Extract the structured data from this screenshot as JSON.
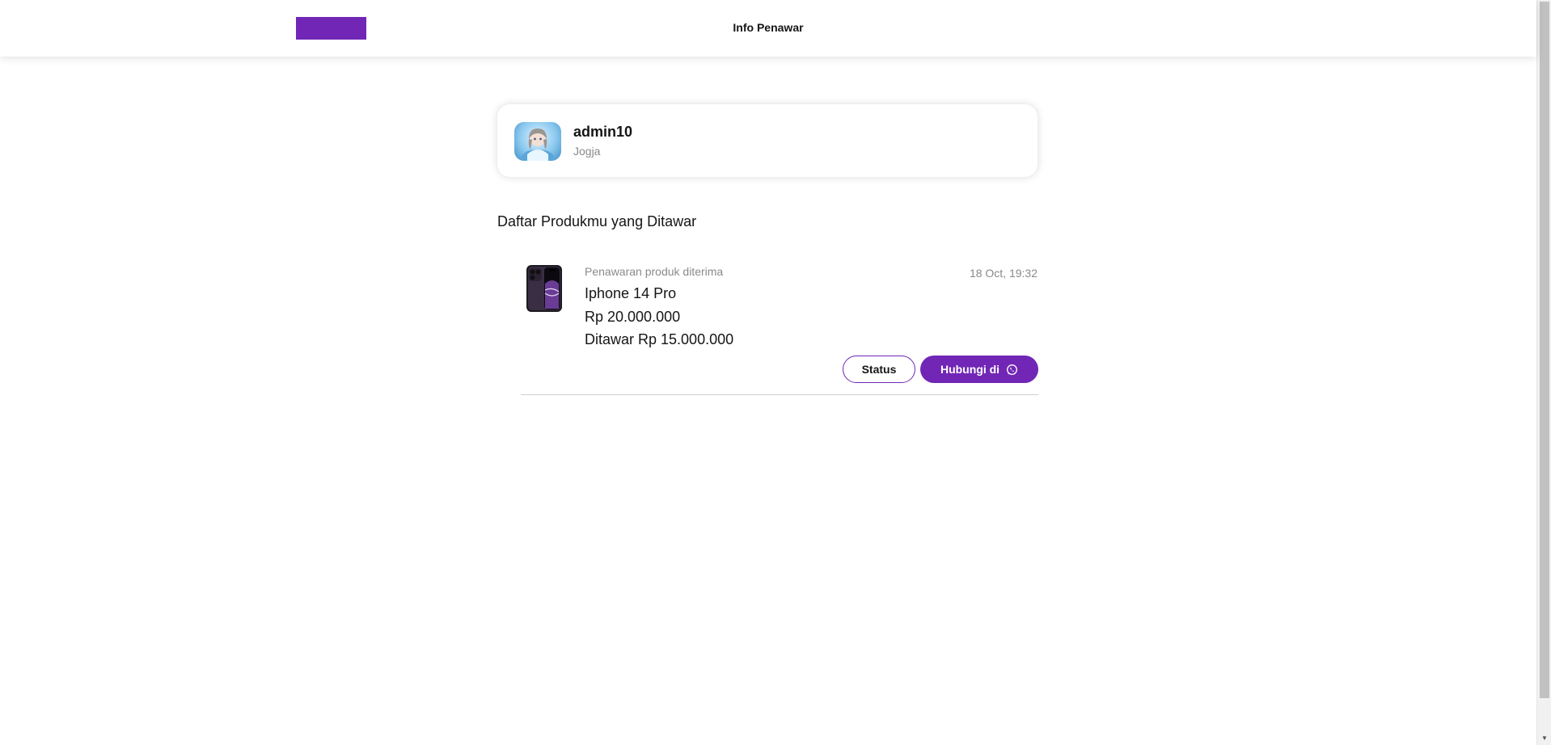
{
  "header": {
    "title": "Info Penawar",
    "logo_color": "#7126B5"
  },
  "buyer": {
    "name": "admin10",
    "city": "Jogja",
    "avatar_icon": "user-avatar"
  },
  "section": {
    "title": "Daftar Produkmu yang Ditawar"
  },
  "offer": {
    "status_text": "Penawaran produk diterima",
    "date": "18 Oct, 19:32",
    "product_name": "Iphone 14 Pro",
    "product_price": "Rp 20.000.000",
    "offer_price": "Ditawar Rp 15.000.000",
    "status_button_label": "Status",
    "contact_button_label": "Hubungi di",
    "contact_icon": "whatsapp-icon"
  },
  "colors": {
    "primary": "#7126B5",
    "text": "#151515",
    "muted": "#8A8A8A"
  }
}
